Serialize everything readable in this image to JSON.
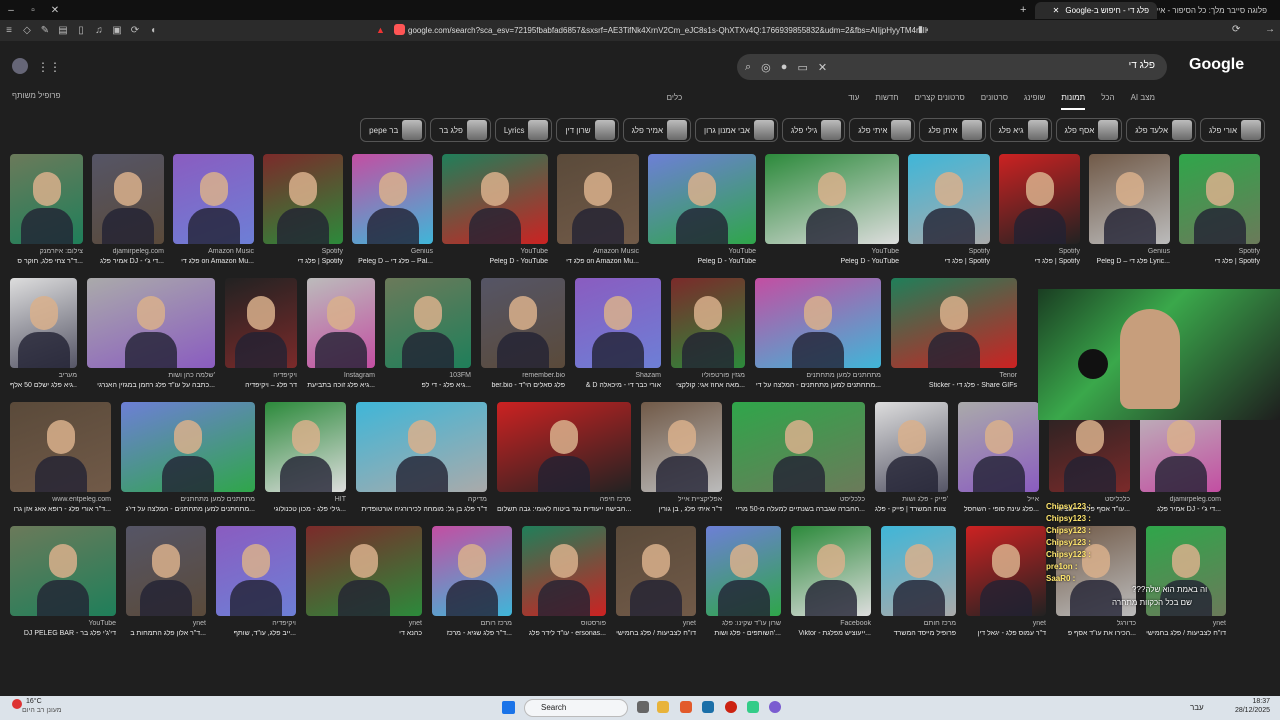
{
  "browser": {
    "tabs": [
      {
        "label": "פלג די - חיפוש ב-Google"
      },
      {
        "label": "פלוגה סייבר מלך: כל הסיפור - אייפונ"
      }
    ],
    "url": "google.com/search?sca_esv=72195fbabfad6857&sxsrf=AE3TifNk4XrnV2Cm_eJC8s1s-QhXTXv4Q:1766939855832&udm=2&fbs=AIIjpHyyTM4mIKw5l..."
  },
  "google": {
    "logo": "Google",
    "query": "פלג די",
    "safe_search": "פרופיל משותף",
    "tabs": [
      "מצב AI",
      "הכל",
      "תמונות",
      "שופינג",
      "סרטונים",
      "סרטונים קצרים",
      "חדשות",
      "עוד",
      "כלים"
    ],
    "chips": [
      "אורי פלג",
      "אלעד פלג",
      "אסף פלג",
      "גיא פלג",
      "איתן פלג",
      "איתי פלג",
      "גילי פלג",
      "אבי אמנון גרון",
      "אמיר פלג",
      "שרון דין",
      "Lyrics",
      "פלג בר",
      "בר pepe"
    ],
    "row1": [
      {
        "src": "צילום: איזרמנק",
        "title": "ד\"ר צחי פלג, חוקר ס..."
      },
      {
        "src": "djamirpeleg.com",
        "title": "אמיר פלג DJ - די ג'י..."
      },
      {
        "src": "Amazon Music",
        "title": "פלג די on Amazon Mu..."
      },
      {
        "src": "Spotify",
        "title": "פלג די | Spotify"
      },
      {
        "src": "Genius",
        "title": "Peleg D – פלג די – Pal..."
      },
      {
        "src": "YouTube",
        "title": "Peleg D - YouTube"
      },
      {
        "src": "Amazon Music",
        "title": "פלג די on Amazon Mu..."
      },
      {
        "src": "YouTube",
        "title": "Peleg D - YouTube"
      },
      {
        "src": "YouTube",
        "title": "Peleg D - YouTube"
      },
      {
        "src": "Spotify",
        "title": "פלג די | Spotify"
      },
      {
        "src": "Spotify",
        "title": "פלג די | Spotify"
      },
      {
        "src": "Genius",
        "title": "Peleg D – פלג די Lyric..."
      },
      {
        "src": "Spotify",
        "title": "פלג די | Spotify"
      }
    ],
    "row2": [
      {
        "src": "מעריב",
        "title": "גיא פלג ישלם 50 אלף..."
      },
      {
        "src": "שלמה כהן ושות'",
        "title": "כתבה על עו\"ד פלג רחמן במגזין האנרגי..."
      },
      {
        "src": "ויקיפדיה",
        "title": "דר פלג – ויקיפדיה"
      },
      {
        "src": "Instagram",
        "title": "גיא פלג זוכה בתביעת..."
      },
      {
        "src": "103FM",
        "title": "גיא פלג - די לפ..."
      },
      {
        "src": "remember.bio",
        "title": "ber.bio - פלג סאלים הי\"ד"
      },
      {
        "src": "Shazam",
        "title": "& D אורי כבר די - מיכאלה"
      },
      {
        "src": "מגזין פורטפוליו",
        "title": "מאה אחוז אגי: קולקצי..."
      },
      {
        "src": "מתחתנים למען מתחתנים",
        "title": "מתחתנים למען מתחתנים - המלצה על די..."
      },
      {
        "src": "Tenor",
        "title": "Sticker - פלג די - Share GIFs"
      }
    ],
    "row3": [
      {
        "src": "www.entpeleg.com",
        "title": "ד\"ר אורי פלג - רופא אאג אזן גרו..."
      },
      {
        "src": "מתחתנים למען מתחתנים",
        "title": "מתחתנים למען מתחתנים - המלצה על די'ג..."
      },
      {
        "src": "HIT",
        "title": "גילי פלג - מכון טכנולוגי..."
      },
      {
        "src": "מדיקה",
        "title": "ד\"ר פלג בן גל: מומחה לכירורגיה אורטופדית"
      },
      {
        "src": "מרכז חיפה",
        "title": "חבישה ייעודית נגד ביטוח לאומי: גבה תשלום..."
      },
      {
        "src": "אפליקציית אייל",
        "title": "ד\"ר איתי פלג , בן גורין"
      },
      {
        "src": "כלכליסט",
        "title": "החברה שגברה בשנתיים למעלה מ-50 מריי..."
      },
      {
        "src": "פייק - פלג ושות'",
        "title": "צוות המשרד | פייק - פלג ..."
      },
      {
        "src": "אייל",
        "title": "פלג עינת סופי - השחסל..."
      },
      {
        "src": "כלכליסט",
        "title": "עו\"ד אסף פלג - ייעוצית..."
      },
      {
        "src": "djamirpeleg.com",
        "title": "אמיר פלג DJ - די ג'י..."
      }
    ],
    "row4": [
      {
        "src": "YouTube",
        "title": "DJ PELEG BAR - די'ג'י פלג בר"
      },
      {
        "src": "ynet",
        "title": "ד\"ר אלון פלג התמחות ב..."
      },
      {
        "src": "ויקיפדיה",
        "title": "ייב פלג, עו\"ד, שותף..."
      },
      {
        "src": "ynet",
        "title": "כהנא די"
      },
      {
        "src": "מרכז רותם",
        "title": "ד\"ר פלג שגיא - מרכז..."
      },
      {
        "src": "פורסטוס",
        "title": "עו\"ד לידר פלג - ersonas..."
      },
      {
        "src": "ynet",
        "title": "דו\"ח לצביעות / פלג בחמישי"
      },
      {
        "src": "שרון עו\"ד שקינו: פלג",
        "title": "השותפים - פלג ושות'..."
      },
      {
        "src": "Facebook",
        "title": "Viktor - ייעוציש מפלגת..."
      },
      {
        "src": "מרכז חותם",
        "title": "פרופיל מייסד המשרד"
      },
      {
        "src": "ynet",
        "title": "ד\"ר עמוס פלג - יגאל דין"
      },
      {
        "src": "כדורגל",
        "title": "הכירו את עו\"ד אסף פ..."
      },
      {
        "src": "ynet",
        "title": "דו\"ח לצביעות / פלג בחמישי"
      }
    ]
  },
  "stream": {
    "chat": [
      "Chipsy123 :",
      "Chipsy123 :",
      "Chipsy123 :",
      "Chipsy123 :",
      "Chipsy123 :",
      "pre1on :",
      "SaaR0 :"
    ],
    "overlay_text": "???וה באמת הוא שלה",
    "overlay_text2": "שם בכל הכקוות מתחרה"
  },
  "taskbar": {
    "weather": "16°C",
    "weather_sub": "מעונן רב היום",
    "search": "Search",
    "time": "18:37",
    "date": "28/12/2025",
    "lang": "עבר"
  }
}
